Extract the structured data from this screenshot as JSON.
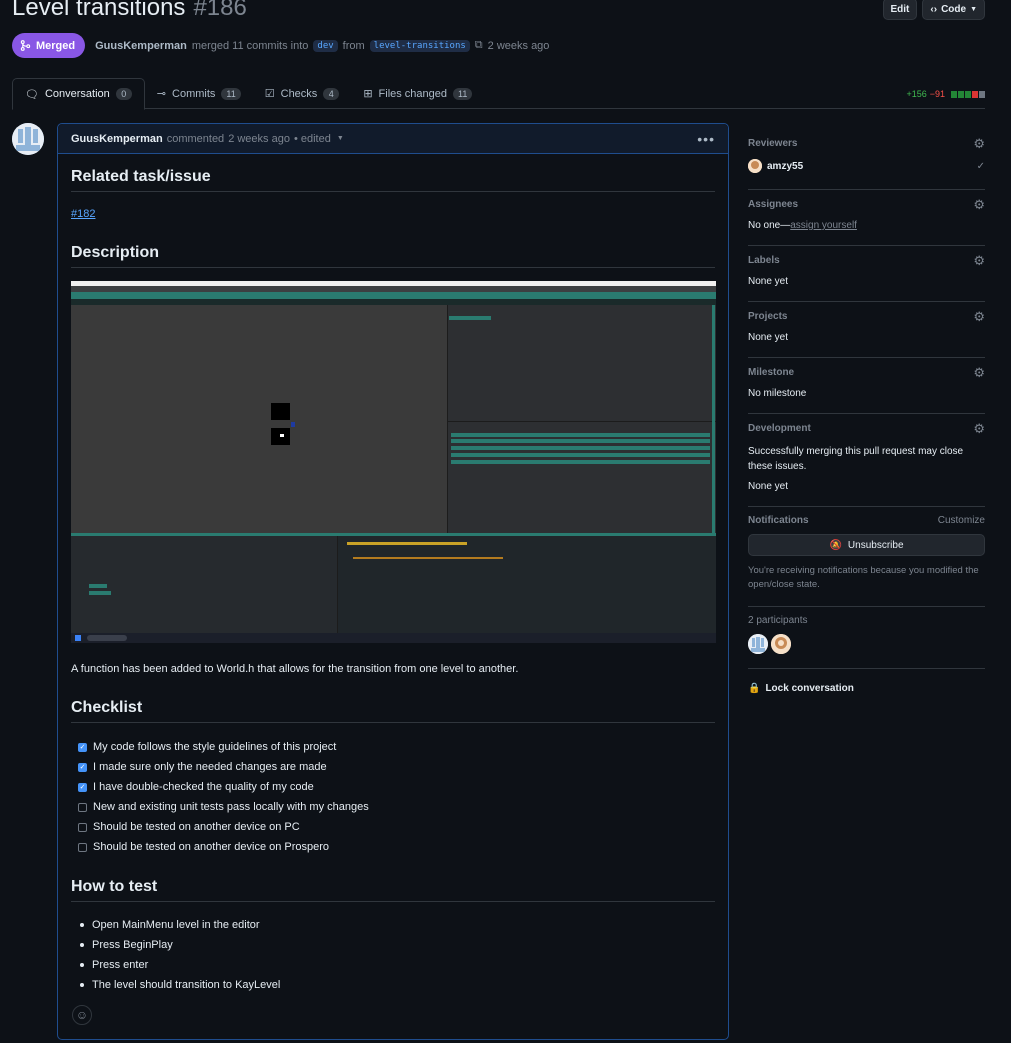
{
  "header": {
    "title": "Level transitions",
    "number": "#186",
    "edit_label": "Edit",
    "code_label": "Code",
    "status_label": "Merged",
    "author": "GuusKemperman",
    "merge_text": "merged 11 commits into",
    "base_branch": "dev",
    "from_text": "from",
    "head_branch": "level-transitions",
    "time": "2 weeks ago"
  },
  "tabs": [
    {
      "label": "Conversation",
      "count": "0",
      "icon": "comment-discussion-icon"
    },
    {
      "label": "Commits",
      "count": "11",
      "icon": "git-commit-icon"
    },
    {
      "label": "Checks",
      "count": "4",
      "icon": "checklist-icon"
    },
    {
      "label": "Files changed",
      "count": "11",
      "icon": "file-diff-icon"
    }
  ],
  "diffstat": {
    "additions": "+156",
    "deletions": "−91"
  },
  "comment": {
    "author": "GuusKemperman",
    "action": "commented",
    "time": "2 weeks ago",
    "edited": "• edited",
    "related_heading": "Related task/issue",
    "issue_link": "#182",
    "description_heading": "Description",
    "description_text": "A function has been added to World.h that allows for the transition from one level to another.",
    "checklist_heading": "Checklist",
    "checklist": [
      {
        "text": "My code follows the style guidelines of this project",
        "checked": true
      },
      {
        "text": "I made sure only the needed changes are made",
        "checked": true
      },
      {
        "text": "I have double-checked the quality of my code",
        "checked": true
      },
      {
        "text": "New and existing unit tests pass locally with my changes",
        "checked": false
      },
      {
        "text": "Should be tested on another device on PC",
        "checked": false
      },
      {
        "text": "Should be tested on another device on Prospero",
        "checked": false
      }
    ],
    "howto_heading": "How to test",
    "howto": [
      "Open MainMenu level in the editor",
      "Press BeginPlay",
      "Press enter",
      "The level should transition to KayLevel"
    ]
  },
  "sidebar": {
    "reviewers_label": "Reviewers",
    "reviewer_name": "amzy55",
    "assignees_label": "Assignees",
    "assignees_none": "No one—",
    "assign_yourself": "assign yourself",
    "labels_label": "Labels",
    "labels_value": "None yet",
    "projects_label": "Projects",
    "projects_value": "None yet",
    "milestone_label": "Milestone",
    "milestone_value": "No milestone",
    "development_label": "Development",
    "development_text": "Successfully merging this pull request may close these issues.",
    "development_value": "None yet",
    "notifications_label": "Notifications",
    "customize_label": "Customize",
    "unsubscribe_label": "Unsubscribe",
    "notifications_reason": "You're receiving notifications because you modified the open/close state.",
    "participants_label": "2 participants",
    "lock_label": "Lock conversation"
  },
  "colors": {
    "background": "#0d1117",
    "merged": "#8957e5",
    "accent": "#58a6ff",
    "border_highlight": "#1f4d8e",
    "additions": "#3fb950",
    "deletions": "#f85149"
  }
}
